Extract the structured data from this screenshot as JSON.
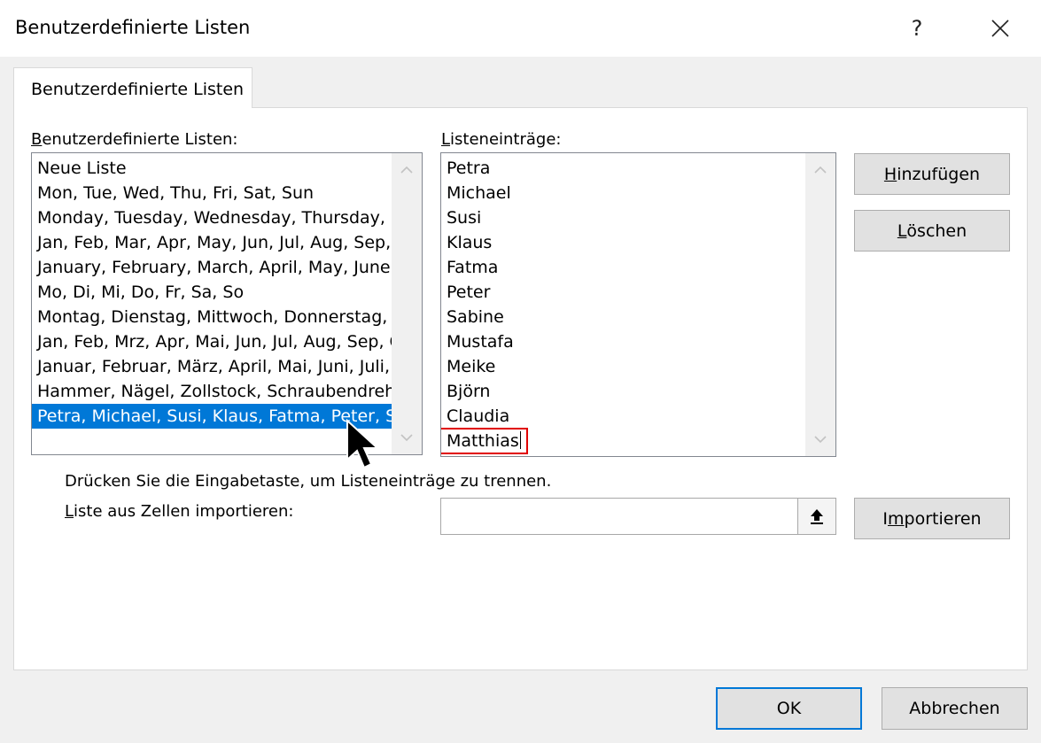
{
  "window": {
    "title": "Benutzerdefinierte Listen",
    "help_label": "?",
    "close_label": "✕"
  },
  "tab": {
    "label": "Benutzerdefinierte Listen"
  },
  "lists": {
    "label_mnemonic": "B",
    "label_rest": "enutzerdefinierte Listen:",
    "items": [
      "Neue Liste",
      "Mon, Tue, Wed, Thu, Fri, Sat, Sun",
      "Monday, Tuesday, Wednesday, Thursday, Fr",
      "Jan, Feb, Mar, Apr, May, Jun, Jul, Aug, Sep, O",
      "January, February, March, April, May, June, J",
      "Mo, Di, Mi, Do, Fr, Sa, So",
      "Montag, Dienstag, Mittwoch, Donnerstag, Fr",
      "Jan, Feb, Mrz, Apr, Mai, Jun, Jul, Aug, Sep, O",
      "Januar, Februar, März, April, Mai, Juni, Juli, A",
      "Hammer, Nägel, Zollstock, Schraubendrehe",
      "Petra, Michael, Susi, Klaus, Fatma, Peter, Sab"
    ],
    "selected_index": 10
  },
  "entries": {
    "label_mnemonic": "L",
    "label_rest": "isteneinträge:",
    "items": [
      "Petra",
      "Michael",
      "Susi",
      "Klaus",
      "Fatma",
      "Peter",
      "Sabine",
      "Mustafa",
      "Meike",
      "Björn",
      "Claudia"
    ],
    "editing": "Matthias"
  },
  "buttons": {
    "add_mnemonic": "H",
    "add_rest": "inzufügen",
    "delete_mnemonic": "L",
    "delete_rest": "öschen",
    "import_pre": "I",
    "import_mnemonic": "m",
    "import_rest": "portieren",
    "ok_label": "OK",
    "cancel_label": "Abbrechen"
  },
  "hints": {
    "separator_hint": "Drücken Sie die Eingabetaste, um Listeneinträge zu trennen.",
    "import_label_mnemonic": "L",
    "import_label_rest": "iste aus Zellen importieren:"
  },
  "import_field": {
    "value": ""
  },
  "icons": {
    "help": "help-icon",
    "close": "close-icon",
    "scroll_up": "chevron-up-icon",
    "scroll_down": "chevron-down-icon",
    "collapse_dialog": "collapse-dialog-icon",
    "mouse_cursor": "mouse-pointer-icon"
  },
  "colors": {
    "selection": "#0078d7",
    "edit_highlight": "#e10000",
    "default_button_border": "#0078d7"
  }
}
